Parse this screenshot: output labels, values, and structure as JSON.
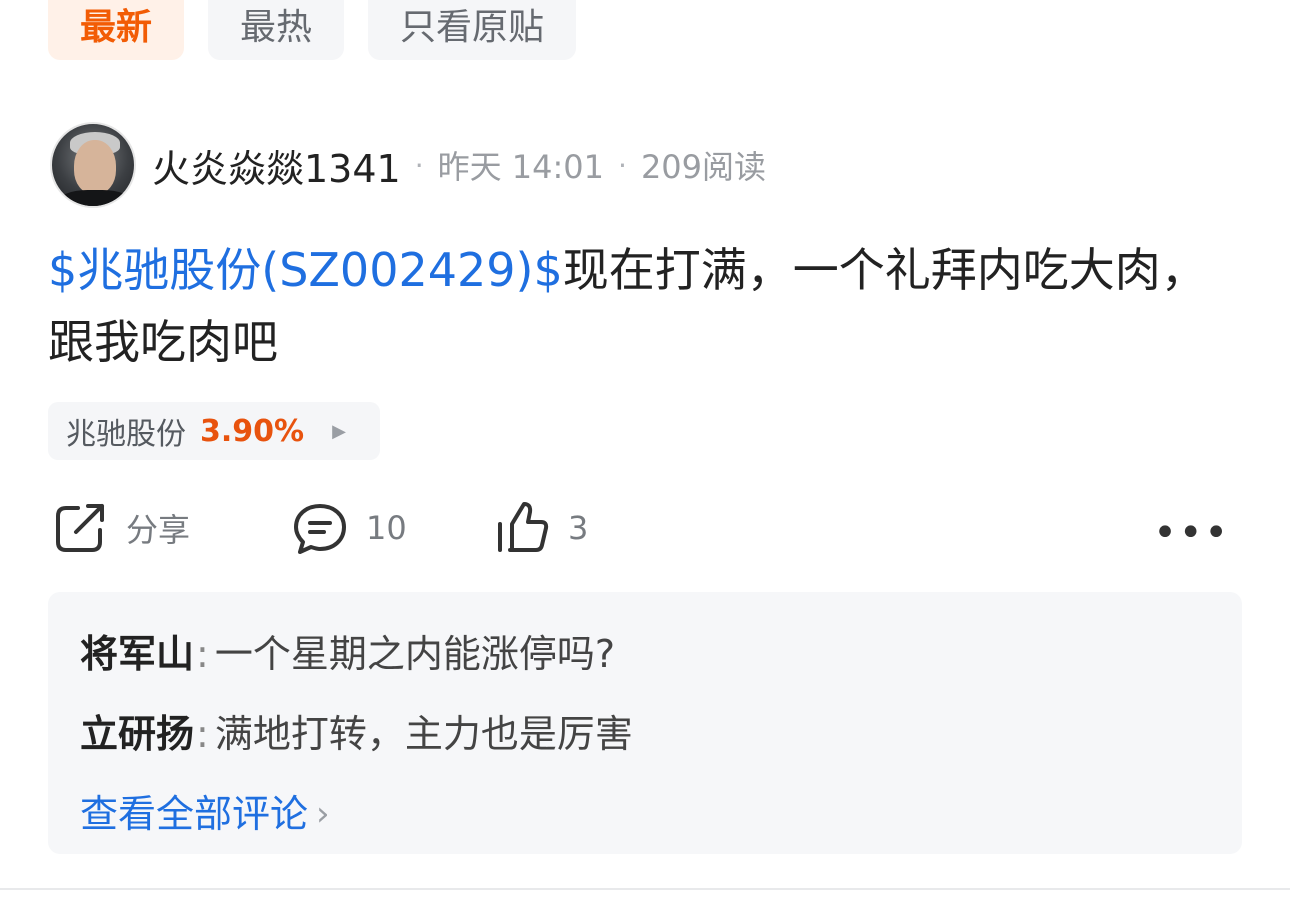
{
  "tabs": [
    {
      "label": "最新",
      "active": true
    },
    {
      "label": "最热",
      "active": false
    },
    {
      "label": "只看原贴",
      "active": false
    }
  ],
  "post": {
    "author": "火炎焱燚1341",
    "time": "昨天 14:01",
    "reads": "209阅读",
    "stock_link": "$兆驰股份(SZ002429)$",
    "text": "现在打满，一个礼拜内吃大肉，跟我吃肉吧",
    "stock_chip": {
      "name": "兆驰股份",
      "change": "3.90%"
    }
  },
  "actions": {
    "share_label": "分享",
    "comment_count": "10",
    "like_count": "3"
  },
  "comments": [
    {
      "user": "将军山",
      "text": "一个星期之内能涨停吗?"
    },
    {
      "user": "立研扬",
      "text": "满地打转，主力也是厉害"
    }
  ],
  "view_all_label": "查看全部评论",
  "colors": {
    "accent": "#f25c05",
    "link": "#1f6fe0",
    "up": "#e8530e"
  }
}
